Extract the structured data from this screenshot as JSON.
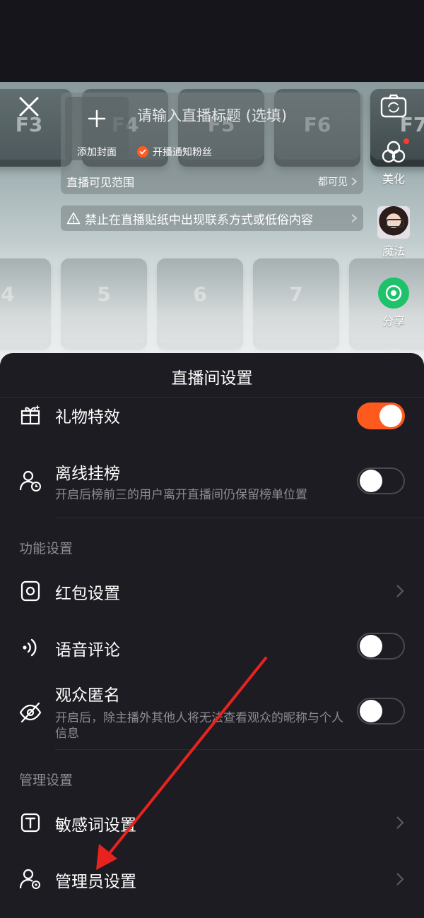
{
  "live_setup": {
    "add_cover_label": "添加封面",
    "title_placeholder": "请输入直播标题 (选填)",
    "notify_fans_label": "开播通知粉丝",
    "visibility_label": "直播可见范围",
    "visibility_value": "都可见",
    "warning_text": "禁止在直播贴纸中出现联系方式或低俗内容"
  },
  "side_tools": [
    {
      "label": "美化",
      "icon": "beauty-icon"
    },
    {
      "label": "魔法",
      "icon": "magic-avatar"
    },
    {
      "label": "分享",
      "icon": "share-icon"
    }
  ],
  "sheet": {
    "title": "直播间设置",
    "rows": {
      "gift_effects": {
        "label": "礼物特效",
        "toggle": true
      },
      "offline_ranking": {
        "label": "离线挂榜",
        "sub": "开启后榜前三的用户离开直播间仍保留榜单位置",
        "toggle": false
      },
      "red_packet": {
        "label": "红包设置"
      },
      "voice_comment": {
        "label": "语音评论",
        "toggle": false
      },
      "anonymous_viewers": {
        "label": "观众匿名",
        "sub": "开启后，除主播外其他人将无法查看观众的昵称与个人信息",
        "toggle": false
      },
      "sensitive_words": {
        "label": "敏感词设置"
      },
      "admin_settings": {
        "label": "管理员设置"
      }
    },
    "sections": {
      "function": "功能设置",
      "management": "管理设置"
    }
  },
  "colors": {
    "accent": "#fe5a1e",
    "sheet_bg": "#1d1c22",
    "annotation_arrow": "#e8231f"
  }
}
